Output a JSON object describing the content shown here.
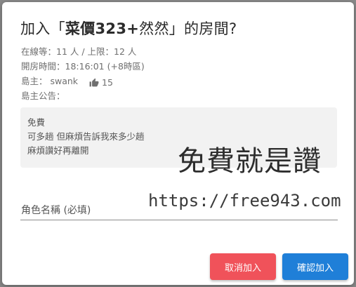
{
  "dialog": {
    "title_prefix": "加入「",
    "title_room": "菜價323+",
    "title_room_suffix": "然然",
    "title_suffix": "」的房間?",
    "online_line": "在線等：11 人 / 上限：12 人",
    "open_time_line": "開房時間：18:16:01 (+8時區)",
    "owner_label": "島主： swank",
    "like_icon": "thumbs-up-icon",
    "like_count": "15",
    "announcement_label": "島主公告：",
    "announcement_lines": [
      "免費",
      "可多趟 但麻煩告訴我來多少趟",
      "麻煩讚好再離開"
    ],
    "field_label": "角色名稱 (必填)",
    "cancel_label": "取消加入",
    "confirm_label": "確認加入",
    "colors": {
      "cancel": "#f0525a",
      "confirm": "#1f7fd8"
    }
  },
  "watermark": {
    "line1": "免費就是讚",
    "line2": "https://free943.com"
  }
}
